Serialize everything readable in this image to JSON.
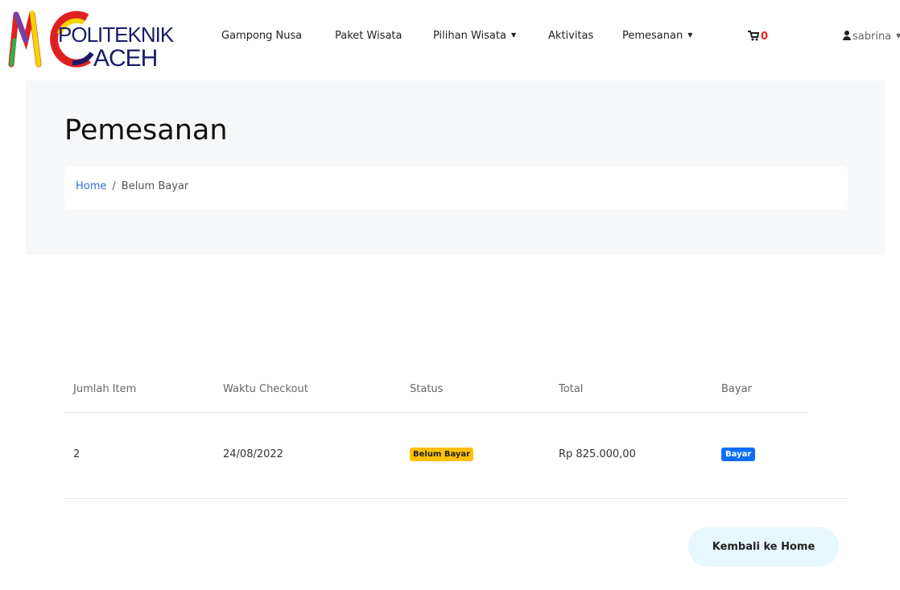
{
  "brand": {
    "line1": "POLITEKNIK",
    "line2": "ACEH",
    "colors": {
      "navy": "#1b1b6b",
      "red": "#e02020",
      "yellow": "#f5d300",
      "purple": "#7b3fa0"
    }
  },
  "nav": {
    "items": [
      {
        "label": "Gampong Nusa",
        "has_dropdown": false
      },
      {
        "label": "Paket Wisata",
        "has_dropdown": false
      },
      {
        "label": "Pilihan Wisata",
        "has_dropdown": true
      },
      {
        "label": "Aktivitas",
        "has_dropdown": false
      },
      {
        "label": "Pemesanan",
        "has_dropdown": true
      }
    ],
    "cart_count": "0",
    "user_name": "sabrina"
  },
  "page": {
    "title": "Pemesanan",
    "breadcrumb": {
      "home": "Home",
      "current": "Belum Bayar"
    }
  },
  "table": {
    "headers": [
      "Jumlah Item",
      "Waktu Checkout",
      "Status",
      "Total",
      "Bayar"
    ],
    "rows": [
      {
        "jumlah_item": "2",
        "waktu_checkout": "24/08/2022",
        "status": "Belum Bayar",
        "total": "Rp 825.000,00",
        "bayar": "Bayar"
      }
    ]
  },
  "actions": {
    "back_home": "Kembali ke Home"
  },
  "icons": {
    "cart": "cart-icon",
    "user": "user-icon",
    "caret": "caret-down-icon"
  }
}
